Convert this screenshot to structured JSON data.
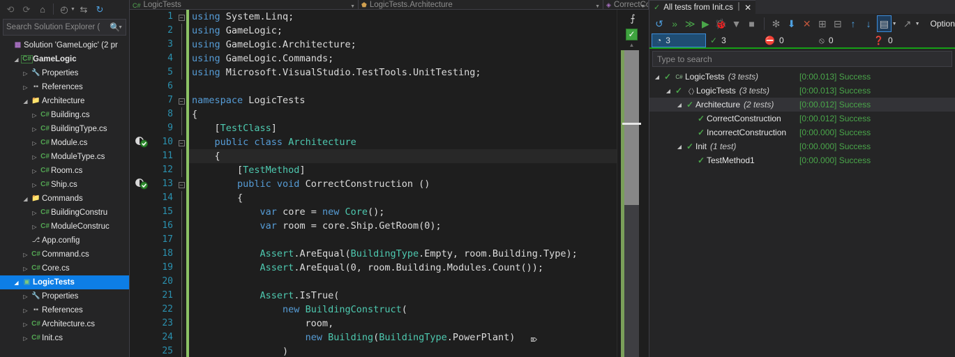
{
  "solution_explorer": {
    "toolbar": [
      {
        "name": "back-icon",
        "glyph": "⟲",
        "state": "dim"
      },
      {
        "name": "forward-icon",
        "glyph": "⟳",
        "state": "dim"
      },
      {
        "name": "home-icon",
        "glyph": "⌂",
        "state": "normal"
      },
      {
        "name": "pending-changes-icon",
        "glyph": "◴",
        "state": "normal"
      },
      {
        "name": "sync-with-active-document-icon",
        "glyph": "⇆",
        "state": "normal"
      },
      {
        "name": "refresh-icon",
        "glyph": "↻",
        "state": "blue"
      }
    ],
    "search_placeholder": "Search Solution Explorer (",
    "tree": [
      {
        "indent": 0,
        "expander": "",
        "icon": "sln-icon",
        "glyph": "▦",
        "icon_class": "ico-sln",
        "label": "Solution 'GameLogic' (2 pr",
        "bold": false,
        "selected": false
      },
      {
        "indent": 1,
        "expander": "◢",
        "icon": "csharp-project-icon",
        "glyph": "C#",
        "icon_class": "ico-proj-cs",
        "label": "GameLogic",
        "bold": true,
        "selected": false
      },
      {
        "indent": 2,
        "expander": "▷",
        "icon": "properties-icon",
        "glyph": "🔧",
        "icon_class": "ico-wrench",
        "label": "Properties",
        "bold": false,
        "selected": false
      },
      {
        "indent": 2,
        "expander": "▷",
        "icon": "references-icon",
        "glyph": "▪▪",
        "icon_class": "ico-refs",
        "label": "References",
        "bold": false,
        "selected": false
      },
      {
        "indent": 2,
        "expander": "◢",
        "icon": "folder-icon",
        "glyph": "📁",
        "icon_class": "ico-folder",
        "label": "Architecture",
        "bold": false,
        "selected": false
      },
      {
        "indent": 3,
        "expander": "▷",
        "icon": "csharp-file-icon",
        "glyph": "C#",
        "icon_class": "ico-cs",
        "label": "Building.cs",
        "bold": false,
        "selected": false
      },
      {
        "indent": 3,
        "expander": "▷",
        "icon": "csharp-file-icon",
        "glyph": "C#",
        "icon_class": "ico-cs",
        "label": "BuildingType.cs",
        "bold": false,
        "selected": false
      },
      {
        "indent": 3,
        "expander": "▷",
        "icon": "csharp-file-icon",
        "glyph": "C#",
        "icon_class": "ico-cs",
        "label": "Module.cs",
        "bold": false,
        "selected": false
      },
      {
        "indent": 3,
        "expander": "▷",
        "icon": "csharp-file-icon",
        "glyph": "C#",
        "icon_class": "ico-cs",
        "label": "ModuleType.cs",
        "bold": false,
        "selected": false
      },
      {
        "indent": 3,
        "expander": "▷",
        "icon": "csharp-file-icon",
        "glyph": "C#",
        "icon_class": "ico-cs",
        "label": "Room.cs",
        "bold": false,
        "selected": false
      },
      {
        "indent": 3,
        "expander": "▷",
        "icon": "csharp-file-icon",
        "glyph": "C#",
        "icon_class": "ico-cs",
        "label": "Ship.cs",
        "bold": false,
        "selected": false
      },
      {
        "indent": 2,
        "expander": "◢",
        "icon": "folder-icon",
        "glyph": "📁",
        "icon_class": "ico-folder",
        "label": "Commands",
        "bold": false,
        "selected": false
      },
      {
        "indent": 3,
        "expander": "▷",
        "icon": "csharp-file-icon",
        "glyph": "C#",
        "icon_class": "ico-cs",
        "label": "BuildingConstru",
        "bold": false,
        "selected": false
      },
      {
        "indent": 3,
        "expander": "▷",
        "icon": "csharp-file-icon",
        "glyph": "C#",
        "icon_class": "ico-cs",
        "label": "ModuleConstruc",
        "bold": false,
        "selected": false
      },
      {
        "indent": 2,
        "expander": "",
        "icon": "config-file-icon",
        "glyph": "⎇",
        "icon_class": "ico-config",
        "label": "App.config",
        "bold": false,
        "selected": false
      },
      {
        "indent": 2,
        "expander": "▷",
        "icon": "csharp-file-icon",
        "glyph": "C#",
        "icon_class": "ico-cs",
        "label": "Command.cs",
        "bold": false,
        "selected": false
      },
      {
        "indent": 2,
        "expander": "▷",
        "icon": "csharp-file-icon",
        "glyph": "C#",
        "icon_class": "ico-cs",
        "label": "Core.cs",
        "bold": false,
        "selected": false
      },
      {
        "indent": 1,
        "expander": "◢",
        "icon": "test-project-icon",
        "glyph": "▣",
        "icon_class": "ico-proj-test",
        "label": "LogicTests",
        "bold": true,
        "selected": true
      },
      {
        "indent": 2,
        "expander": "▷",
        "icon": "properties-icon",
        "glyph": "🔧",
        "icon_class": "ico-wrench",
        "label": "Properties",
        "bold": false,
        "selected": false
      },
      {
        "indent": 2,
        "expander": "▷",
        "icon": "references-icon",
        "glyph": "▪▪",
        "icon_class": "ico-refs",
        "label": "References",
        "bold": false,
        "selected": false
      },
      {
        "indent": 2,
        "expander": "▷",
        "icon": "csharp-file-icon",
        "glyph": "C#",
        "icon_class": "ico-cs",
        "label": "Architecture.cs",
        "bold": false,
        "selected": false
      },
      {
        "indent": 2,
        "expander": "▷",
        "icon": "csharp-file-icon",
        "glyph": "C#",
        "icon_class": "ico-cs",
        "label": "Init.cs",
        "bold": false,
        "selected": false
      }
    ]
  },
  "editor": {
    "navbar": [
      {
        "name": "navbar-project-dropdown",
        "icon": "csharp-project-icon",
        "glyph": "C#",
        "label": "LogicTests"
      },
      {
        "name": "navbar-type-dropdown",
        "icon": "class-icon",
        "glyph": "⬟",
        "label": "LogicTests.Architecture"
      },
      {
        "name": "navbar-member-dropdown",
        "icon": "method-icon",
        "glyph": "◈",
        "label": "CorrectConstruction()"
      }
    ],
    "first_line_number": 1,
    "current_line": 11,
    "lines": [
      {
        "n": 1,
        "fold": "minus",
        "change": true,
        "tokens": [
          {
            "t": "using ",
            "c": "k-blue"
          },
          {
            "t": "System.Linq;",
            "c": "k-plain"
          }
        ]
      },
      {
        "n": 2,
        "fold": "",
        "change": true,
        "guide": true,
        "tokens": [
          {
            "t": "using ",
            "c": "k-blue"
          },
          {
            "t": "GameLogic;",
            "c": "k-plain"
          }
        ]
      },
      {
        "n": 3,
        "fold": "",
        "change": true,
        "guide": true,
        "tokens": [
          {
            "t": "using ",
            "c": "k-blue"
          },
          {
            "t": "GameLogic.Architecture;",
            "c": "k-plain"
          }
        ]
      },
      {
        "n": 4,
        "fold": "",
        "change": true,
        "guide": true,
        "tokens": [
          {
            "t": "using ",
            "c": "k-blue"
          },
          {
            "t": "GameLogic.Commands;",
            "c": "k-plain"
          }
        ]
      },
      {
        "n": 5,
        "fold": "",
        "change": true,
        "guide": true,
        "tokens": [
          {
            "t": "using ",
            "c": "k-blue"
          },
          {
            "t": "Microsoft.VisualStudio.TestTools.UnitTesting;",
            "c": "k-plain"
          }
        ]
      },
      {
        "n": 6,
        "fold": "",
        "change": true,
        "tokens": []
      },
      {
        "n": 7,
        "fold": "minus",
        "change": true,
        "tokens": [
          {
            "t": "namespace ",
            "c": "k-blue"
          },
          {
            "t": "LogicTests",
            "c": "k-plain"
          }
        ]
      },
      {
        "n": 8,
        "fold": "",
        "change": true,
        "guide": true,
        "tokens": [
          {
            "t": "{",
            "c": "k-plain"
          }
        ]
      },
      {
        "n": 9,
        "fold": "",
        "change": true,
        "guide": true,
        "tokens": [
          {
            "t": "    [",
            "c": "k-plain"
          },
          {
            "t": "TestClass",
            "c": "k-green"
          },
          {
            "t": "]",
            "c": "k-plain"
          }
        ]
      },
      {
        "n": 10,
        "fold": "minus",
        "change": true,
        "guide": true,
        "tokens": [
          {
            "t": "    ",
            "c": "k-plain"
          },
          {
            "t": "public class ",
            "c": "k-blue"
          },
          {
            "t": "Architecture",
            "c": "k-green"
          }
        ]
      },
      {
        "n": 11,
        "fold": "",
        "change": true,
        "guide": true,
        "tokens": [
          {
            "t": "    {",
            "c": "k-plain"
          }
        ]
      },
      {
        "n": 12,
        "fold": "",
        "change": true,
        "guide": true,
        "tokens": [
          {
            "t": "        [",
            "c": "k-plain"
          },
          {
            "t": "TestMethod",
            "c": "k-green"
          },
          {
            "t": "]",
            "c": "k-plain"
          }
        ]
      },
      {
        "n": 13,
        "fold": "minus",
        "change": true,
        "guide": true,
        "tokens": [
          {
            "t": "        ",
            "c": "k-plain"
          },
          {
            "t": "public void ",
            "c": "k-blue"
          },
          {
            "t": "CorrectConstruction ()",
            "c": "k-plain"
          }
        ]
      },
      {
        "n": 14,
        "fold": "",
        "change": true,
        "guide": true,
        "tokens": [
          {
            "t": "        {",
            "c": "k-plain"
          }
        ]
      },
      {
        "n": 15,
        "fold": "",
        "change": true,
        "guide": true,
        "tokens": [
          {
            "t": "            ",
            "c": "k-plain"
          },
          {
            "t": "var ",
            "c": "k-blue"
          },
          {
            "t": "core = ",
            "c": "k-plain"
          },
          {
            "t": "new ",
            "c": "k-blue"
          },
          {
            "t": "Core",
            "c": "k-green"
          },
          {
            "t": "();",
            "c": "k-plain"
          }
        ]
      },
      {
        "n": 16,
        "fold": "",
        "change": true,
        "guide": true,
        "tokens": [
          {
            "t": "            ",
            "c": "k-plain"
          },
          {
            "t": "var ",
            "c": "k-blue"
          },
          {
            "t": "room = core.Ship.GetRoom(",
            "c": "k-plain"
          },
          {
            "t": "0",
            "c": "k-plain"
          },
          {
            "t": ");",
            "c": "k-plain"
          }
        ]
      },
      {
        "n": 17,
        "fold": "",
        "change": true,
        "guide": true,
        "tokens": []
      },
      {
        "n": 18,
        "fold": "",
        "change": true,
        "guide": true,
        "tokens": [
          {
            "t": "            ",
            "c": "k-plain"
          },
          {
            "t": "Assert",
            "c": "k-green"
          },
          {
            "t": ".AreEqual(",
            "c": "k-plain"
          },
          {
            "t": "BuildingType",
            "c": "k-green"
          },
          {
            "t": ".Empty, room.Building.Type);",
            "c": "k-plain"
          }
        ]
      },
      {
        "n": 19,
        "fold": "",
        "change": true,
        "guide": true,
        "tokens": [
          {
            "t": "            ",
            "c": "k-plain"
          },
          {
            "t": "Assert",
            "c": "k-green"
          },
          {
            "t": ".AreEqual(",
            "c": "k-plain"
          },
          {
            "t": "0",
            "c": "k-plain"
          },
          {
            "t": ", room.Building.Modules.Count());",
            "c": "k-plain"
          }
        ]
      },
      {
        "n": 20,
        "fold": "",
        "change": true,
        "guide": true,
        "tokens": []
      },
      {
        "n": 21,
        "fold": "",
        "change": true,
        "guide": true,
        "tokens": [
          {
            "t": "            ",
            "c": "k-plain"
          },
          {
            "t": "Assert",
            "c": "k-green"
          },
          {
            "t": ".IsTrue(",
            "c": "k-plain"
          }
        ]
      },
      {
        "n": 22,
        "fold": "",
        "change": true,
        "guide": true,
        "tokens": [
          {
            "t": "                ",
            "c": "k-plain"
          },
          {
            "t": "new ",
            "c": "k-blue"
          },
          {
            "t": "BuildingConstruct",
            "c": "k-green"
          },
          {
            "t": "(",
            "c": "k-plain"
          }
        ]
      },
      {
        "n": 23,
        "fold": "",
        "change": true,
        "guide": true,
        "tokens": [
          {
            "t": "                    room,",
            "c": "k-plain"
          }
        ]
      },
      {
        "n": 24,
        "fold": "",
        "change": true,
        "guide": true,
        "tokens": [
          {
            "t": "                    ",
            "c": "k-plain"
          },
          {
            "t": "new ",
            "c": "k-blue"
          },
          {
            "t": "Building",
            "c": "k-green"
          },
          {
            "t": "(",
            "c": "k-plain"
          },
          {
            "t": "BuildingType",
            "c": "k-green"
          },
          {
            "t": ".PowerPlant)",
            "c": "k-plain"
          }
        ]
      },
      {
        "n": 25,
        "fold": "",
        "change": true,
        "guide": true,
        "tokens": [
          {
            "t": "                )",
            "c": "k-plain"
          }
        ]
      }
    ],
    "test_glyph_lines": [
      10,
      13
    ],
    "right_gutter": {
      "split_icon": "split-view-icon",
      "split_glyph": "⨍",
      "health_icon": "code-health-ok-icon",
      "health_glyph": "✓",
      "scroll_up_glyph": "▲"
    }
  },
  "test_explorer": {
    "tab": {
      "icon": "test-passed-icon",
      "check_glyph": "✓",
      "title": "All tests from Init.cs",
      "pin_glyph": "⏐",
      "close_glyph": "✕"
    },
    "toolbar": [
      {
        "name": "run-all-tests-icon",
        "glyph": "↺",
        "cls": "blue"
      },
      {
        "name": "run-tests-icon",
        "glyph": "»",
        "cls": "green"
      },
      {
        "name": "run-failed-tests-icon",
        "glyph": "≫",
        "cls": "green"
      },
      {
        "name": "play-run-icon",
        "glyph": "▶",
        "cls": "green"
      },
      {
        "name": "debug-tests-icon",
        "glyph": "🐞",
        "cls": "gray"
      },
      {
        "name": "analyze-coverage-icon",
        "glyph": "▼",
        "cls": "gray"
      },
      {
        "name": "stop-icon",
        "glyph": "■",
        "cls": "gray"
      },
      {
        "name": "separator",
        "glyph": "",
        "cls": "sep"
      },
      {
        "name": "group-by-icon",
        "glyph": "✻",
        "cls": "gray"
      },
      {
        "name": "import-results-icon",
        "glyph": "⬇",
        "cls": "blue"
      },
      {
        "name": "clear-results-icon",
        "glyph": "✕",
        "cls": "red"
      },
      {
        "name": "expand-all-icon",
        "glyph": "⊞",
        "cls": "gray"
      },
      {
        "name": "collapse-all-icon",
        "glyph": "⊟",
        "cls": "gray"
      },
      {
        "name": "previous-icon",
        "glyph": "↑",
        "cls": "blue"
      },
      {
        "name": "next-icon",
        "glyph": "↓",
        "cls": "blue"
      },
      {
        "name": "settings-icon",
        "glyph": "▤",
        "cls": "boxed"
      },
      {
        "name": "open-external-icon",
        "glyph": "↗",
        "cls": "gray"
      }
    ],
    "options_label": "Option",
    "status": [
      {
        "name": "total-tests-stat",
        "icon": "tests-total-icon",
        "glyph": "◔",
        "color": "#d8d8d8",
        "count": "3",
        "active": true
      },
      {
        "name": "passed-tests-stat",
        "icon": "check-icon",
        "glyph": "✓",
        "color": "#4aa64a",
        "count": "3",
        "active": false
      },
      {
        "name": "failed-tests-stat",
        "icon": "failed-icon",
        "glyph": "⛔",
        "color": "#d46a5a",
        "count": "0",
        "active": false
      },
      {
        "name": "skipped-tests-stat",
        "icon": "skipped-icon",
        "glyph": "⦸",
        "color": "#b0b0b0",
        "count": "0",
        "active": false
      },
      {
        "name": "notrun-tests-stat",
        "icon": "question-icon",
        "glyph": "❓",
        "color": "#3c9fd8",
        "count": "0",
        "active": false
      }
    ],
    "search_placeholder": "Type to search",
    "tree": [
      {
        "indent": 0,
        "expander": "◢",
        "check": "✓",
        "icon": "csharp-assembly-icon",
        "glyph": "C#",
        "name": "LogicTests",
        "count": "(3 tests)",
        "duration": "[0:00.013]",
        "result": "Success",
        "selected": false
      },
      {
        "indent": 1,
        "expander": "◢",
        "check": "✓",
        "icon": "namespace-icon",
        "glyph": "〈〉",
        "name": "LogicTests",
        "count": "(3 tests)",
        "duration": "[0:00.013]",
        "result": "Success",
        "selected": false
      },
      {
        "indent": 2,
        "expander": "◢",
        "check": "✓",
        "icon": "",
        "glyph": "",
        "name": "Architecture",
        "count": "(2 tests)",
        "duration": "[0:00.012]",
        "result": "Success",
        "selected": true
      },
      {
        "indent": 3,
        "expander": "",
        "check": "✓",
        "icon": "",
        "glyph": "",
        "name": "CorrectConstruction",
        "count": "",
        "duration": "[0:00.012]",
        "result": "Success",
        "selected": false
      },
      {
        "indent": 3,
        "expander": "",
        "check": "✓",
        "icon": "",
        "glyph": "",
        "name": "IncorrectConstruction",
        "count": "",
        "duration": "[0:00.000]",
        "result": "Success",
        "selected": false
      },
      {
        "indent": 2,
        "expander": "◢",
        "check": "✓",
        "icon": "",
        "glyph": "",
        "name": "Init",
        "count": "(1 test)",
        "duration": "[0:00.000]",
        "result": "Success",
        "selected": false
      },
      {
        "indent": 3,
        "expander": "",
        "check": "✓",
        "icon": "",
        "glyph": "",
        "name": "TestMethod1",
        "count": "",
        "duration": "[0:00.000]",
        "result": "Success",
        "selected": false
      }
    ]
  }
}
